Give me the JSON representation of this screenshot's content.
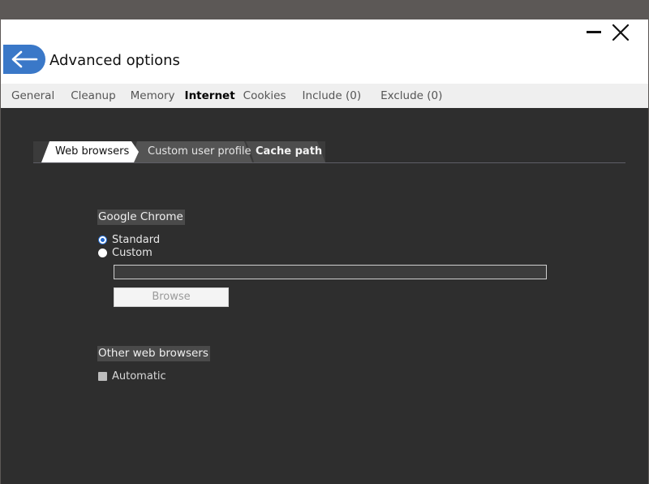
{
  "window": {
    "title": "Advanced options"
  },
  "tabs": [
    {
      "label": "General"
    },
    {
      "label": "Cleanup"
    },
    {
      "label": "Memory"
    },
    {
      "label": "Internet",
      "active": true
    },
    {
      "label": "Cookies"
    },
    {
      "label": "Include (0)"
    },
    {
      "label": "Exclude (0)"
    }
  ],
  "subtabs": [
    {
      "label": "Web browsers",
      "selected": true
    },
    {
      "label": "Custom user profile"
    },
    {
      "label": "Cache path",
      "bold": true
    }
  ],
  "chrome": {
    "heading": "Google Chrome",
    "option_standard": "Standard",
    "option_custom": "Custom",
    "selected": "Standard",
    "path_value": "",
    "browse_label": "Browse"
  },
  "other": {
    "heading": "Other web browsers",
    "automatic_label": "Automatic",
    "automatic_checked": false
  },
  "colors": {
    "accent": "#3a78c8",
    "window_bg": "#2e2e2e",
    "tabbar_bg": "#efefef"
  }
}
